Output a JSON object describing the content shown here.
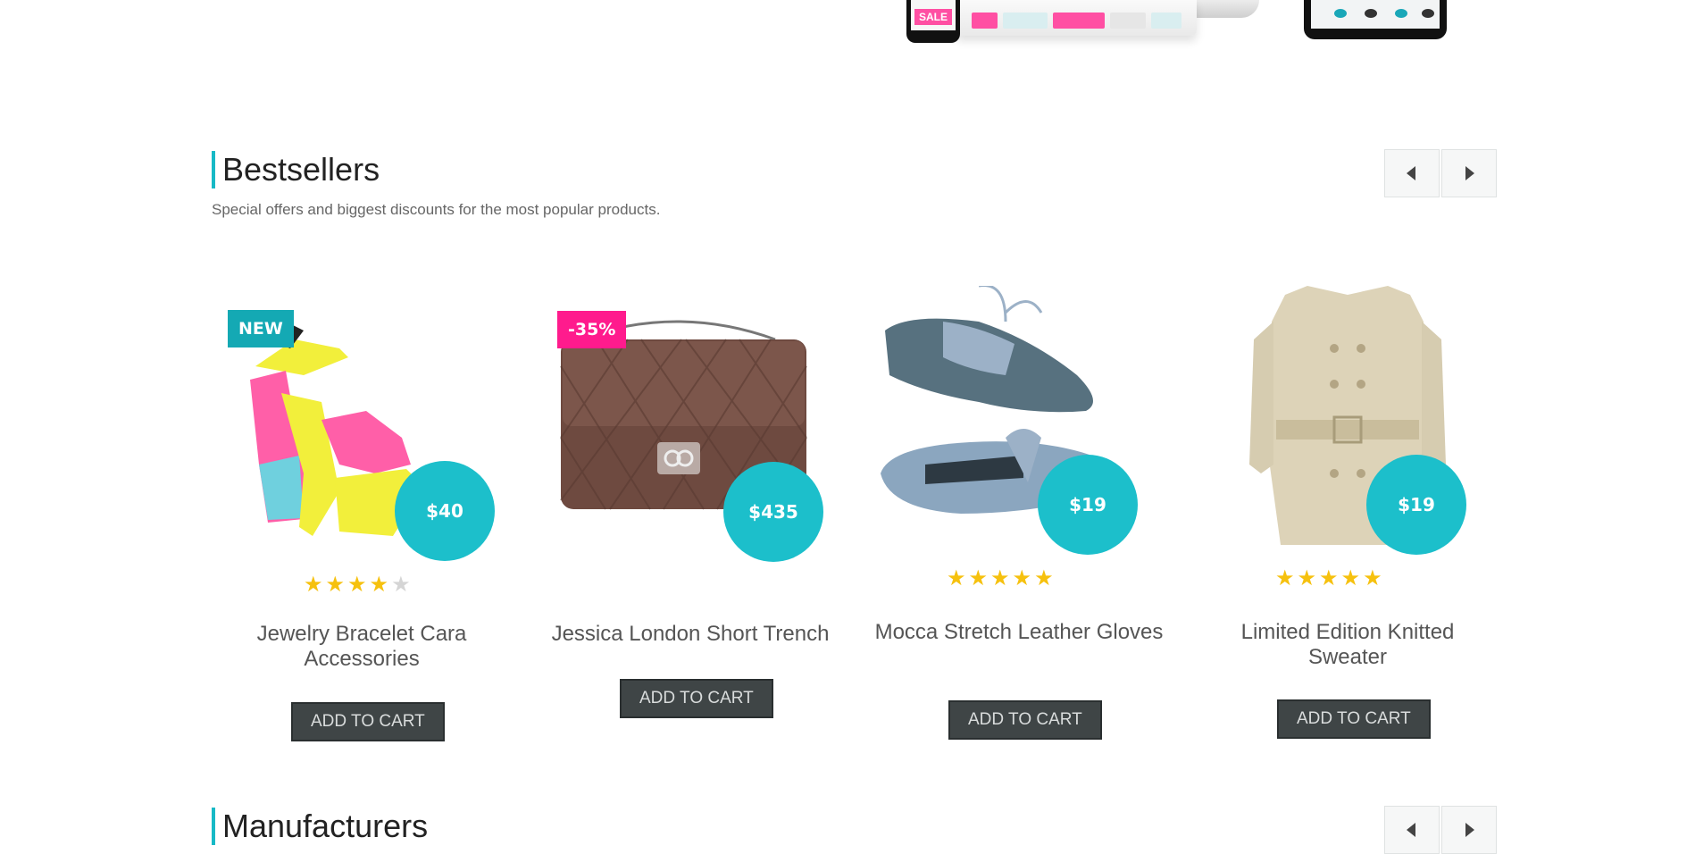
{
  "hero": {
    "phone_badge": "SALE",
    "colors": {
      "sale_pink": "#ff4fa3",
      "accent": "#17b9c6"
    }
  },
  "bestsellers": {
    "title": "Bestsellers",
    "subtitle": "Special offers and biggest discounts for the most popular products.",
    "nav": {
      "prev_icon": "triangle-left-icon",
      "next_icon": "triangle-right-icon"
    }
  },
  "products": [
    {
      "badge": "NEW",
      "badge_type": "new",
      "price": "$40",
      "rating": 4,
      "rating_max": 5,
      "title": "Jewelry Bracelet Cara Accessories",
      "button": "ADD TO CART"
    },
    {
      "badge": "-35%",
      "badge_type": "sale",
      "price": "$435",
      "rating": 0,
      "rating_max": 5,
      "title": "Jessica London Short Trench",
      "button": "ADD TO CART"
    },
    {
      "badge": "",
      "badge_type": "",
      "price": "$19",
      "rating": 5,
      "rating_max": 5,
      "title": "Mocca Stretch Leather Gloves",
      "button": "ADD TO CART"
    },
    {
      "badge": "",
      "badge_type": "",
      "price": "$19",
      "rating": 5,
      "rating_max": 5,
      "title": "Limited Edition Knitted Sweater",
      "button": "ADD TO CART"
    }
  ],
  "manufacturers": {
    "title": "Manufacturers",
    "nav": {
      "prev_icon": "triangle-left-icon",
      "next_icon": "triangle-right-icon"
    }
  },
  "colors": {
    "accent": "#17b9c6",
    "price_circle": "#1cbfcb",
    "badge_new": "#14a9b4",
    "badge_sale": "#ff1b8d",
    "star_on": "#f6c10e",
    "star_off": "#d5d5d5",
    "button_bg": "#3f4546"
  }
}
